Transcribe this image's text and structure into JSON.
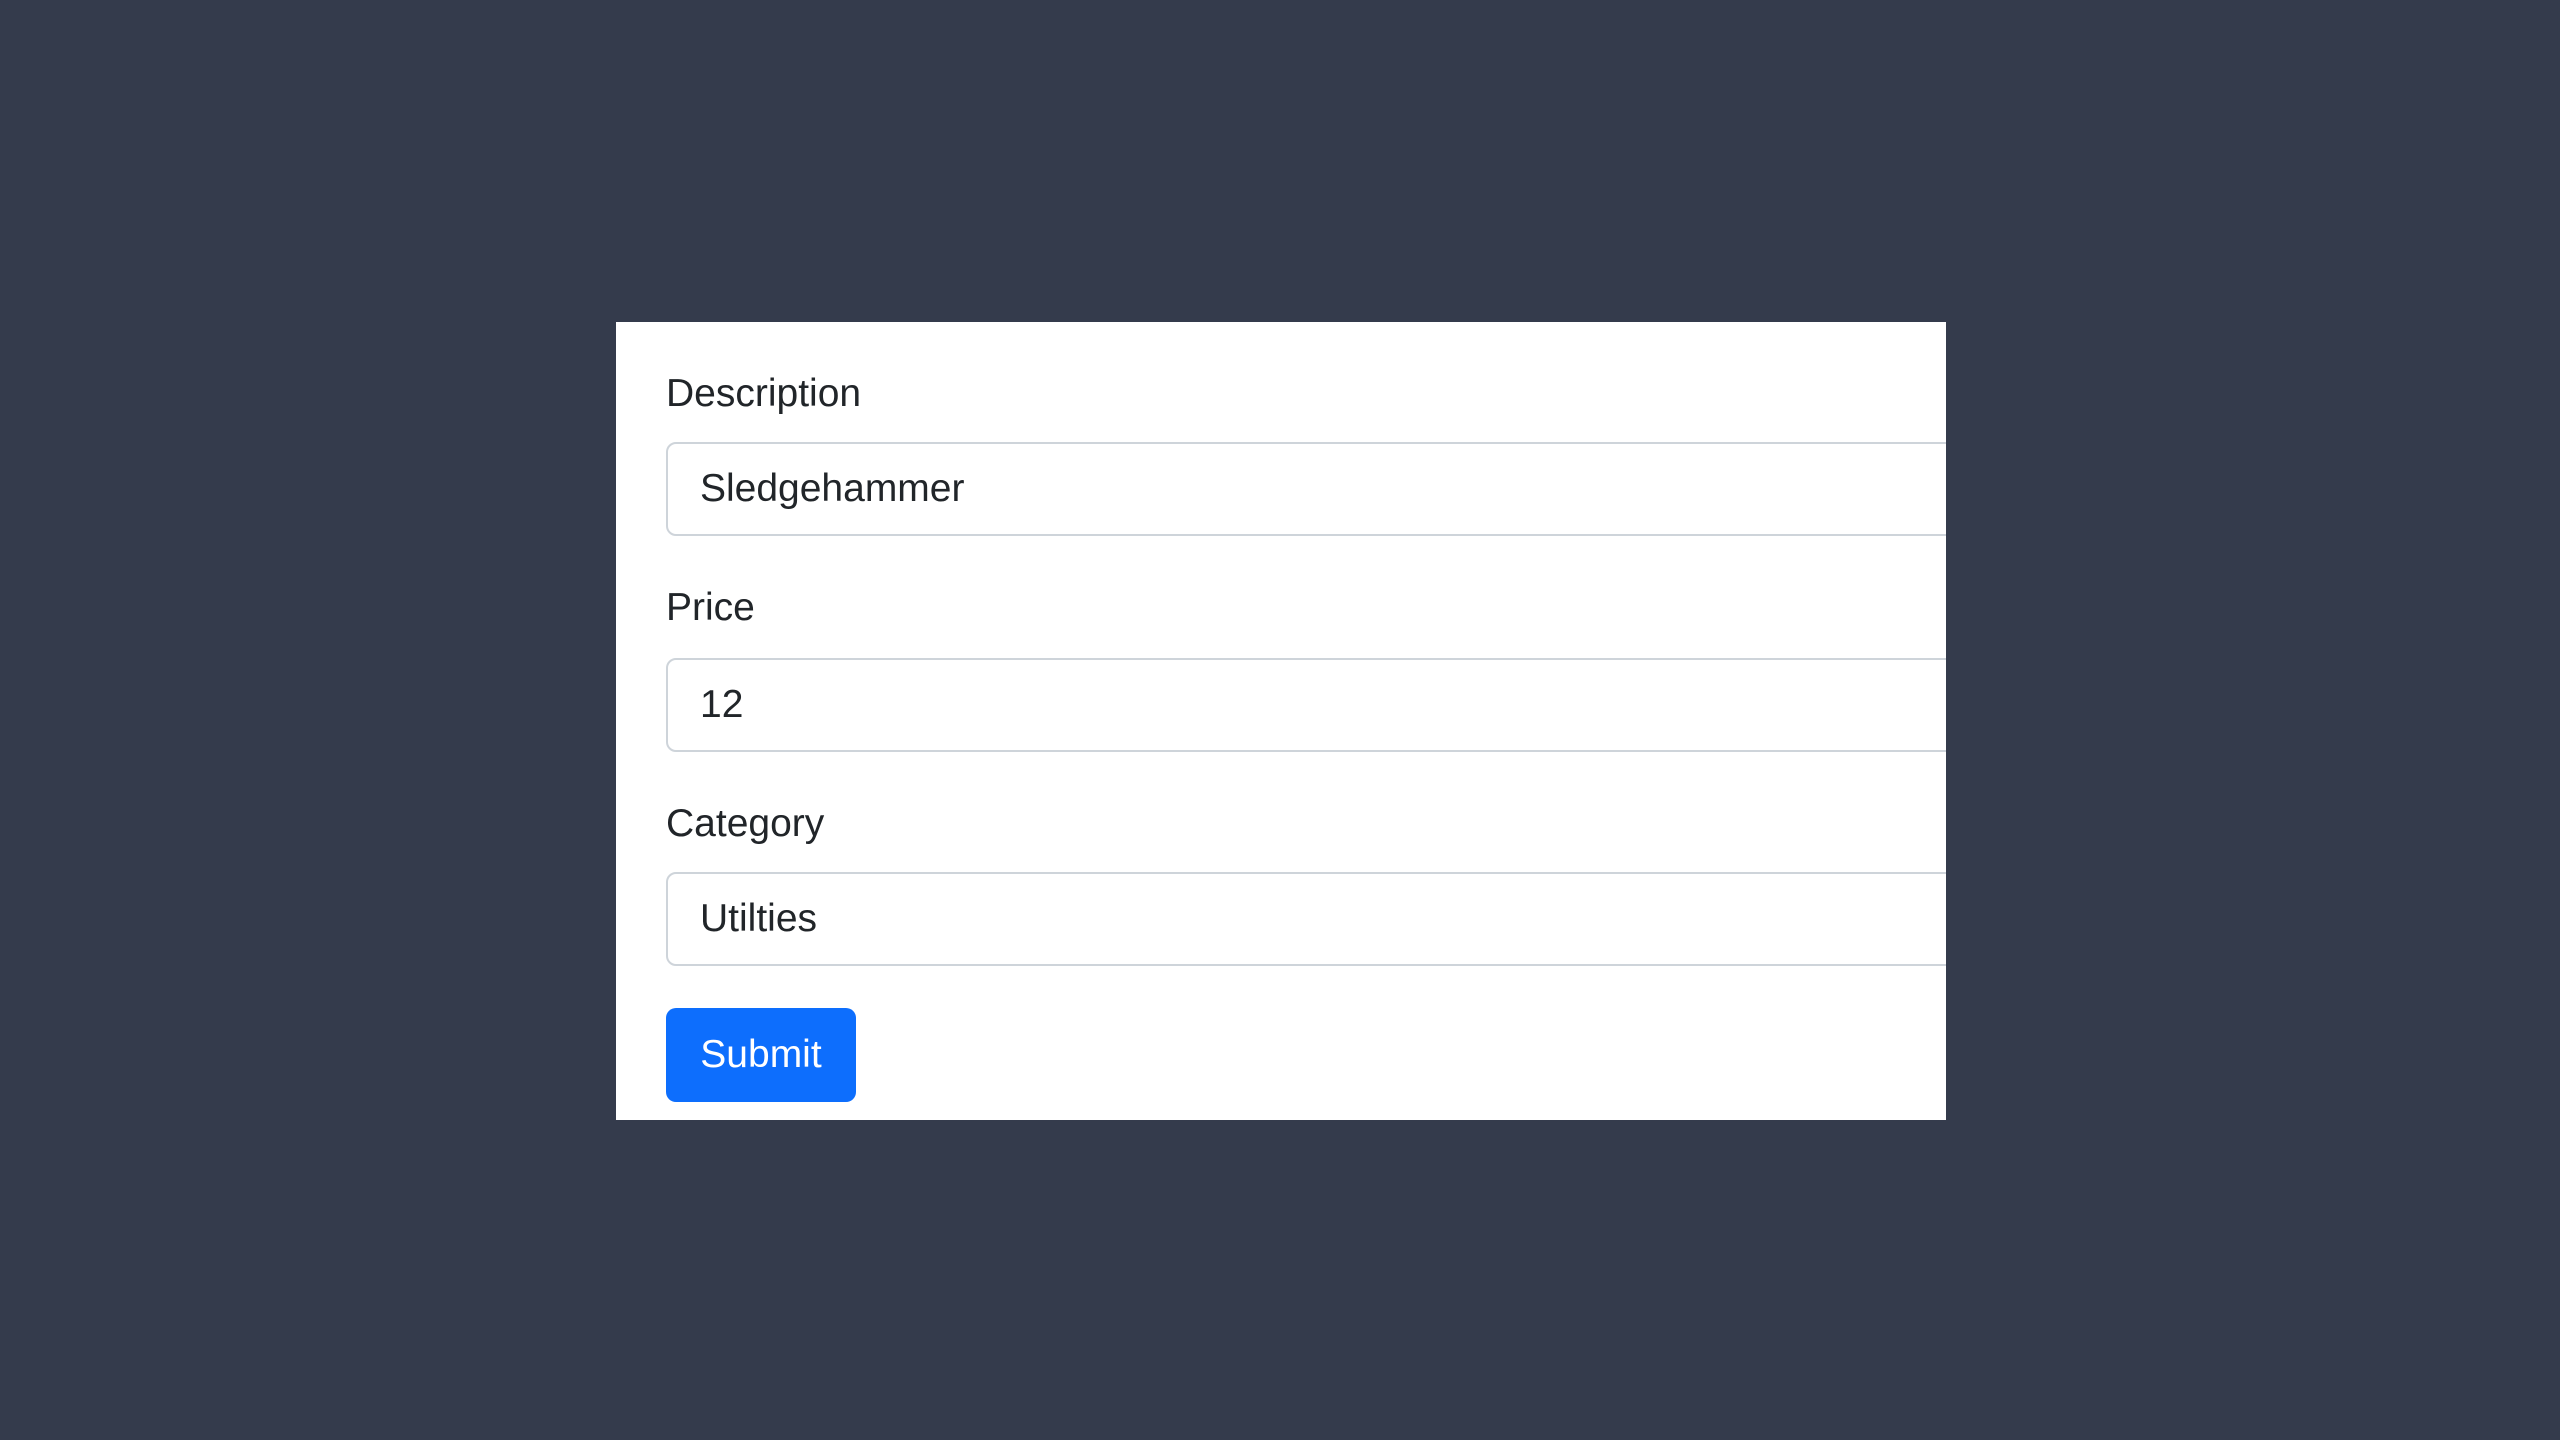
{
  "form": {
    "description": {
      "label": "Description",
      "value": "Sledgehammer"
    },
    "price": {
      "label": "Price",
      "value": "12"
    },
    "category": {
      "label": "Category",
      "value": "Utilties"
    },
    "submit_label": "Submit"
  },
  "colors": {
    "page_background": "#343b4c",
    "card_background": "#ffffff",
    "primary_button": "#0d6efd",
    "input_border": "#ced4da",
    "text": "#212529"
  }
}
